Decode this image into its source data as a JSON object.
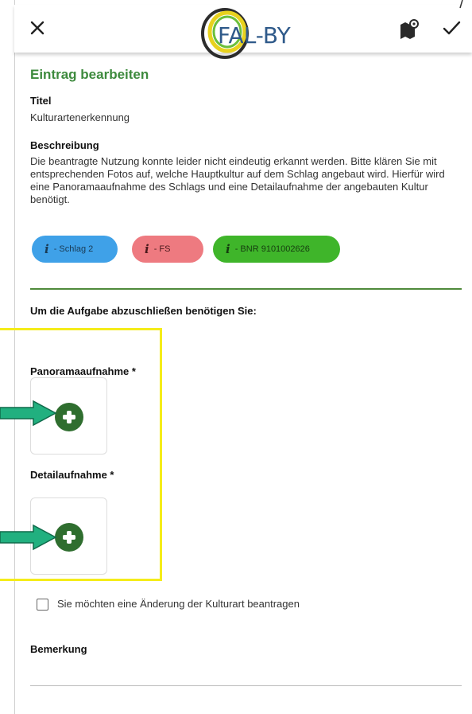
{
  "header": {
    "logo_text": "FAL-BY"
  },
  "form": {
    "heading": "Eintrag bearbeiten",
    "title_label": "Titel",
    "title_value": "Kulturartenerkennung",
    "description_label": "Beschreibung",
    "description_text": "Die beantragte Nutzung konnte leider nicht eindeutig erkannt werden. Bitte klären Sie mit entsprechenden Fotos auf, welche Hauptkultur auf dem Schlag angebaut wird. Hierfür wird eine Panoramaaufnahme des Schlags und eine Detailaufnahme der angebauten Kultur benötigt.",
    "chips": [
      {
        "icon": "i",
        "label": "- Schlag 2",
        "color": "#3fa1e8"
      },
      {
        "icon": "i",
        "label": "- FS",
        "color": "#ee7a80"
      },
      {
        "icon": "i",
        "label": "- BNR 9101002626",
        "color": "#3fb52a"
      }
    ],
    "task_prompt": "Um die Aufgabe abzuschließen benötigen Sie:",
    "panorama_label": "Panoramaaufnahme *",
    "detail_label": "Detailaufnahme *",
    "change_request_label": "Sie möchten eine Änderung der Kulturart beantragen",
    "remark_label": "Bemerkung"
  },
  "colors": {
    "accent_green": "#3d8a3d",
    "highlight_yellow": "#f5ec1a",
    "arrow_teal": "#21b07f"
  }
}
